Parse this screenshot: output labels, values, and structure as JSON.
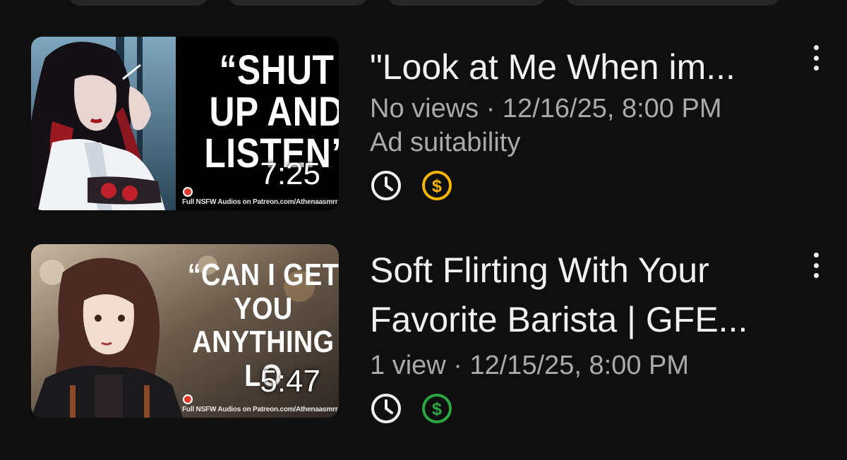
{
  "chips": [
    "",
    "",
    "",
    ""
  ],
  "videos": [
    {
      "thumbnail_text": "“SHUT UP AND LISTEN”",
      "thumbnail_footer": "Full NSFW Audios on Patreon.com/Athenaasmrr",
      "duration": "7:25",
      "title": "\"Look at Me When im...",
      "meta_line": "No views · 12/16/25, 8:00 PM",
      "meta_line_2": "Ad suitability",
      "schedule_icon": "clock-icon",
      "monetization_icon": "dollar-icon",
      "monetization_color": "#f4b400",
      "menu_icon": "more-vert-icon"
    },
    {
      "thumbnail_text": "“CAN I GET YOU ANYTHING LO",
      "thumbnail_footer": "Full NSFW Audios on Patreon.com/Athenaasmrr",
      "duration": "5:47",
      "title_line_1": "Soft Flirting With Your",
      "title_line_2": "Favorite Barista | GFE...",
      "meta_line": "1 view · 12/15/25, 8:00 PM",
      "schedule_icon": "clock-icon",
      "monetization_icon": "dollar-icon",
      "monetization_color": "#2ba640",
      "menu_icon": "more-vert-icon"
    }
  ]
}
